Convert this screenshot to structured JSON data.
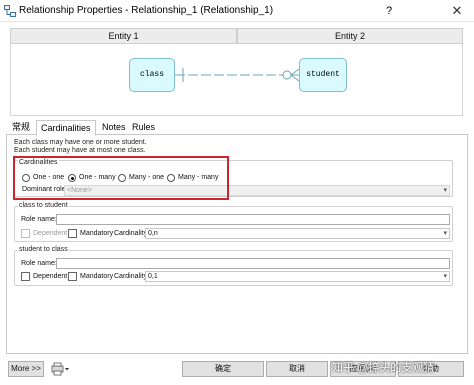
{
  "window": {
    "title": "Relationship Properties - Relationship_1 (Relationship_1)",
    "help_label": "?",
    "close_label": "✕"
  },
  "entities": {
    "left_header": "Entity 1",
    "right_header": "Entity 2",
    "left_name": "class",
    "right_name": "student"
  },
  "tabs": [
    {
      "label": "常规"
    },
    {
      "label": "Cardinalities"
    },
    {
      "label": "Notes"
    },
    {
      "label": "Rules"
    }
  ],
  "active_tab": "Cardinalities",
  "description": {
    "line1": "Each class may have one or more student.",
    "line2": "Each student may have at most one class."
  },
  "cardinalities": {
    "legend": "Cardinalities",
    "options": [
      "One - one",
      "One - many",
      "Many - one",
      "Many - many"
    ],
    "selected": "One - many",
    "dominant_role_label": "Dominant role:",
    "dominant_role_value": "<None>"
  },
  "class_to_student": {
    "legend": "class to student",
    "role_name_label": "Role name:",
    "role_name_value": "",
    "dependent_label": "Dependent",
    "mandatory_label": "Mandatory",
    "cardinality_label": "Cardinality:",
    "cardinality_value": "0,n"
  },
  "student_to_class": {
    "legend": "student to class",
    "role_name_label": "Role name:",
    "role_name_value": "",
    "dependent_label": "Dependent",
    "mandatory_label": "Mandatory",
    "cardinality_label": "Cardinality:",
    "cardinality_value": "0,1"
  },
  "footer": {
    "more_label": "More >>",
    "ok_label": "确定",
    "cancel_label": "取消",
    "apply_label": "应用(A)",
    "help_label": "帮助"
  },
  "watermark": "知乎 @捺头的支观猜",
  "colors": {
    "entity_fill": "#d9fbff",
    "entity_border": "#7fc0cc",
    "highlight": "#c8262c",
    "link_line": "#6aa6b8"
  }
}
